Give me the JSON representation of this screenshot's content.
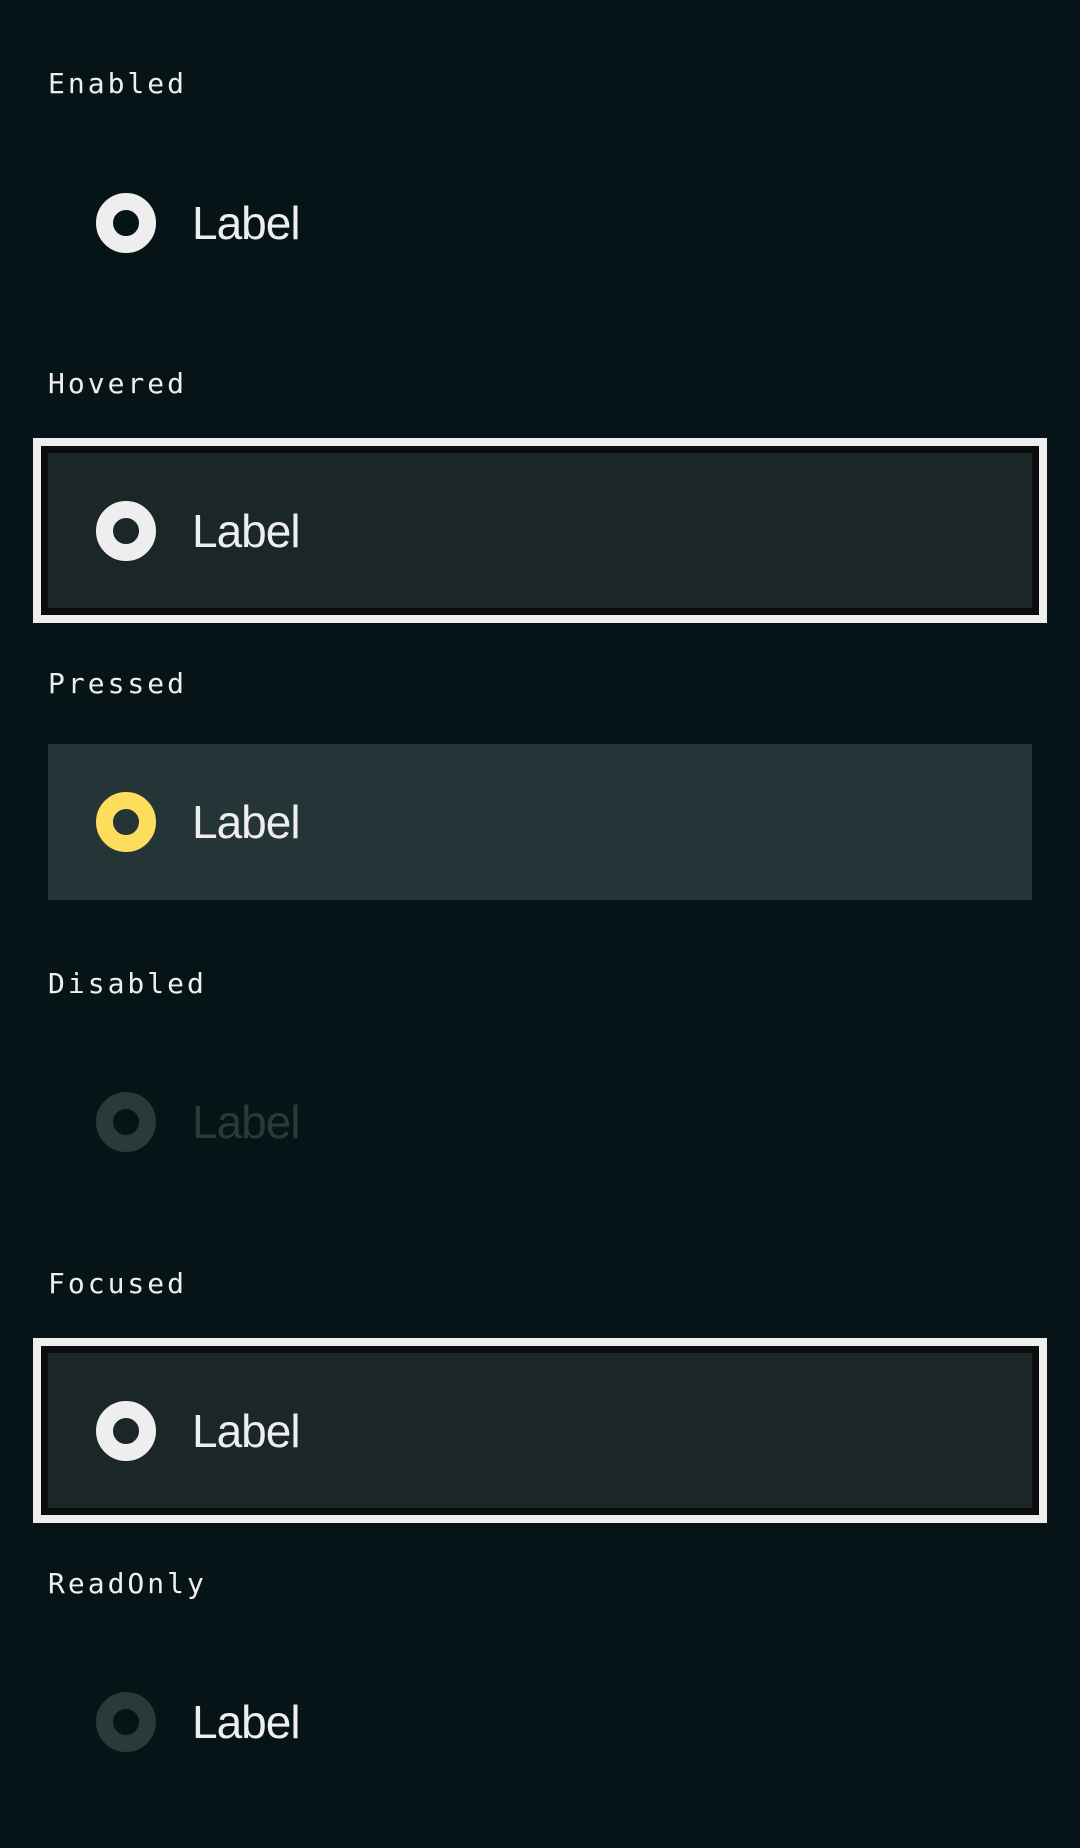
{
  "colors": {
    "background": "#071417",
    "text": "#eeeeee",
    "accent": "#fddd5c",
    "disabled": "#2c393b",
    "hover_bg": "#1b2628",
    "pressed_bg": "#253436",
    "focus_ring": "#eeeeee"
  },
  "states": [
    {
      "title": "Enabled",
      "label": "Label",
      "radio_icon": "radio-selected-icon"
    },
    {
      "title": "Hovered",
      "label": "Label",
      "radio_icon": "radio-selected-icon"
    },
    {
      "title": "Pressed",
      "label": "Label",
      "radio_icon": "radio-selected-icon"
    },
    {
      "title": "Disabled",
      "label": "Label",
      "radio_icon": "radio-selected-icon"
    },
    {
      "title": "Focused",
      "label": "Label",
      "radio_icon": "radio-selected-icon"
    },
    {
      "title": "ReadOnly",
      "label": "Label",
      "radio_icon": "radio-selected-icon"
    }
  ]
}
